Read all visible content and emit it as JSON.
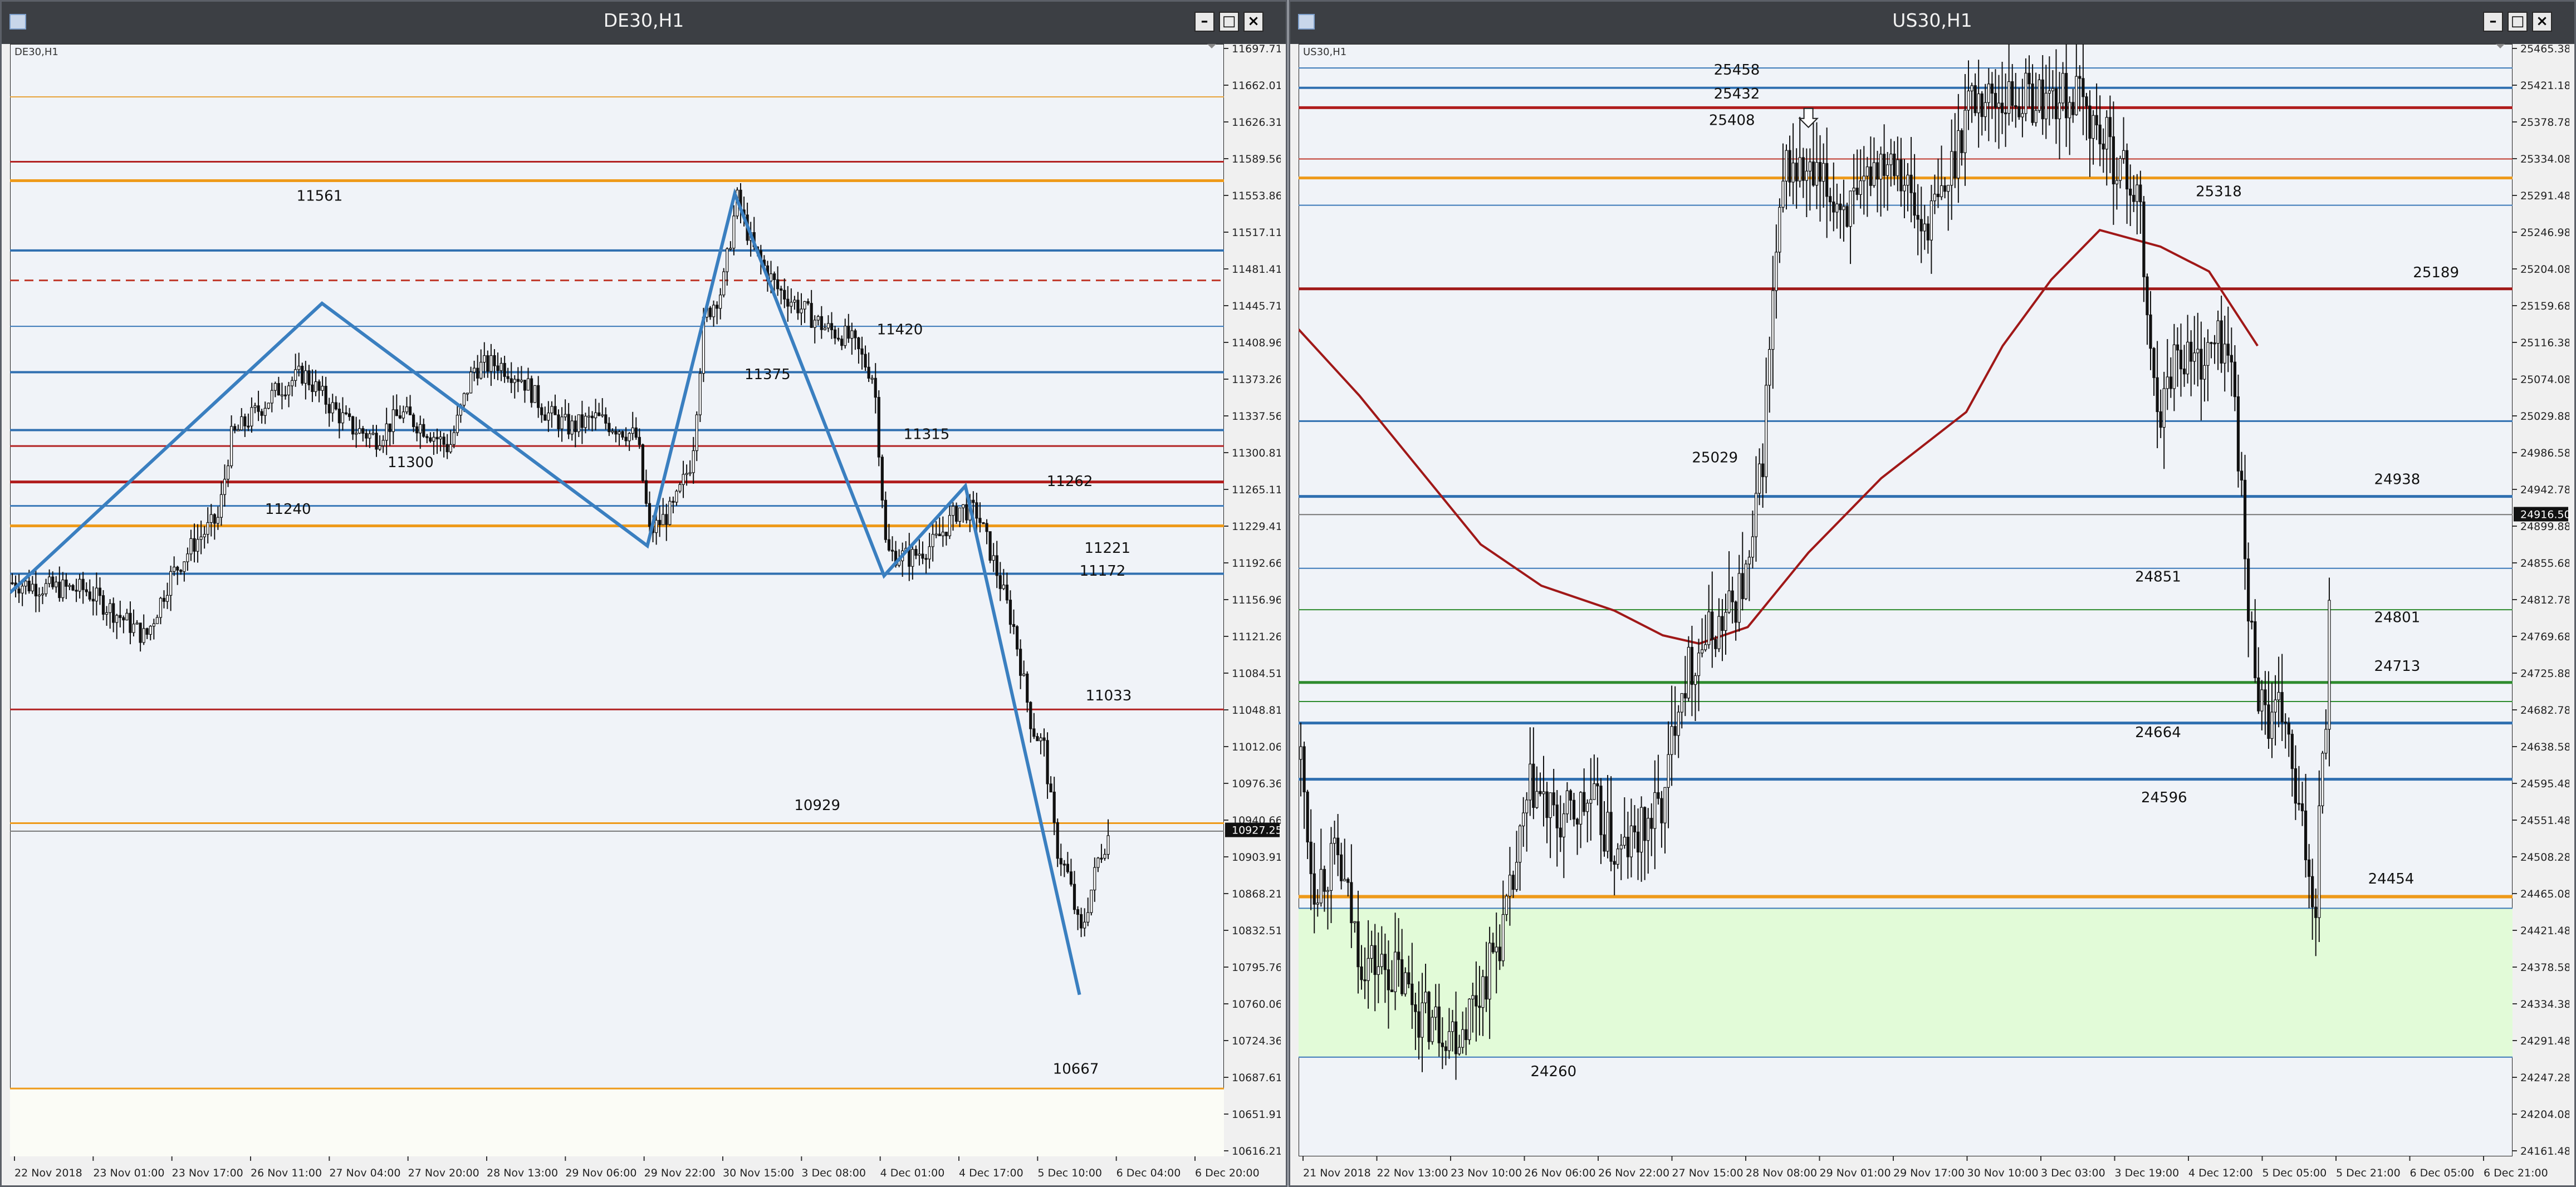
{
  "windows": [
    {
      "id": "de30",
      "title": "DE30,H1",
      "symbol_label": "DE30,H1",
      "min": 10600,
      "max": 11715,
      "y_ticks": [
        "11697.71",
        "11662.01",
        "11626.31",
        "11589.56",
        "11553.86",
        "11517.11",
        "11481.41",
        "11445.71",
        "11408.96",
        "11373.26",
        "11337.56",
        "11300.81",
        "11265.11",
        "11229.41",
        "11192.66",
        "11156.96",
        "11121.26",
        "11084.51",
        "11048.81",
        "11012.06",
        "10976.36",
        "10940.66",
        "10903.91",
        "10868.21",
        "10832.51",
        "10795.76",
        "10760.06",
        "10724.36",
        "10687.61",
        "10651.91",
        "10616.21"
      ],
      "price_tag": "10927.25",
      "price_tag_value": 10927.25,
      "x_labels": [
        "22 Nov 2018",
        "23 Nov 01:00",
        "23 Nov 17:00",
        "26 Nov 11:00",
        "27 Nov 04:00",
        "27 Nov 20:00",
        "28 Nov 13:00",
        "29 Nov 06:00",
        "29 Nov 22:00",
        "30 Nov 15:00",
        "3 Dec 08:00",
        "4 Dec 01:00",
        "4 Dec 17:00",
        "5 Dec 10:00",
        "6 Dec 04:00",
        "6 Dec 20:00"
      ],
      "levels": [
        {
          "v": 11662,
          "color": "#e8a33a",
          "w": 2,
          "dash": false
        },
        {
          "v": 11597,
          "color": "#b22222",
          "w": 3,
          "dash": false
        },
        {
          "v": 11578,
          "color": "#ee9a1a",
          "w": 5,
          "dash": false
        },
        {
          "v": 11508,
          "color": "#2f6fb0",
          "w": 4,
          "dash": false
        },
        {
          "v": 11478,
          "color": "#c0392b",
          "w": 3,
          "dash": true
        },
        {
          "v": 11432,
          "color": "#3a78b8",
          "w": 2,
          "dash": false
        },
        {
          "v": 11386,
          "color": "#2f6fb0",
          "w": 4,
          "dash": false
        },
        {
          "v": 11328,
          "color": "#2f6fb0",
          "w": 4,
          "dash": false
        },
        {
          "v": 11312,
          "color": "#b22222",
          "w": 3,
          "dash": false
        },
        {
          "v": 11276,
          "color": "#b01c1c",
          "w": 5,
          "dash": false
        },
        {
          "v": 11252,
          "color": "#3a78b8",
          "w": 3,
          "dash": false
        },
        {
          "v": 11232,
          "color": "#ee9a1a",
          "w": 5,
          "dash": false
        },
        {
          "v": 11184,
          "color": "#2f6fb0",
          "w": 4,
          "dash": false
        },
        {
          "v": 11048,
          "color": "#b22222",
          "w": 3,
          "dash": false
        },
        {
          "v": 10934,
          "color": "#ee9a1a",
          "w": 3,
          "dash": false
        },
        {
          "v": 10926,
          "color": "#777777",
          "w": 2,
          "dash": false
        },
        {
          "v": 10668,
          "color": "#ee9a1a",
          "w": 3,
          "dash": false
        }
      ],
      "labels": [
        {
          "text": "11561",
          "xf": 0.255,
          "v": 11558
        },
        {
          "text": "11420",
          "xf": 0.733,
          "v": 11424
        },
        {
          "text": "11375",
          "xf": 0.624,
          "v": 11379
        },
        {
          "text": "11315",
          "xf": 0.755,
          "v": 11319
        },
        {
          "text": "11300",
          "xf": 0.33,
          "v": 11291
        },
        {
          "text": "11262",
          "xf": 0.873,
          "v": 11272
        },
        {
          "text": "11240",
          "xf": 0.229,
          "v": 11244
        },
        {
          "text": "11221",
          "xf": 0.904,
          "v": 11205
        },
        {
          "text": "11172",
          "xf": 0.9,
          "v": 11182
        },
        {
          "text": "11033",
          "xf": 0.905,
          "v": 11057
        },
        {
          "text": "10929",
          "xf": 0.665,
          "v": 10947
        },
        {
          "text": "10667",
          "xf": 0.878,
          "v": 10683
        }
      ],
      "pattern": [
        [
          0.0,
          11165
        ],
        [
          0.257,
          11455
        ],
        [
          0.525,
          11212
        ],
        [
          0.597,
          11565
        ],
        [
          0.72,
          11182
        ],
        [
          0.787,
          11272
        ],
        [
          0.881,
          10762
        ]
      ],
      "path": [
        [
          0,
          11175
        ],
        [
          0.03,
          11170
        ],
        [
          0.06,
          11168
        ],
        [
          0.09,
          11140
        ],
        [
          0.11,
          11120
        ],
        [
          0.13,
          11180
        ],
        [
          0.15,
          11215
        ],
        [
          0.17,
          11240
        ],
        [
          0.18,
          11320
        ],
        [
          0.2,
          11345
        ],
        [
          0.22,
          11370
        ],
        [
          0.24,
          11385
        ],
        [
          0.26,
          11355
        ],
        [
          0.28,
          11330
        ],
        [
          0.3,
          11320
        ],
        [
          0.32,
          11345
        ],
        [
          0.34,
          11330
        ],
        [
          0.36,
          11310
        ],
        [
          0.38,
          11390
        ],
        [
          0.4,
          11395
        ],
        [
          0.42,
          11380
        ],
        [
          0.44,
          11345
        ],
        [
          0.46,
          11330
        ],
        [
          0.48,
          11340
        ],
        [
          0.5,
          11330
        ],
        [
          0.515,
          11320
        ],
        [
          0.525,
          11225
        ],
        [
          0.545,
          11250
        ],
        [
          0.56,
          11300
        ],
        [
          0.57,
          11440
        ],
        [
          0.585,
          11470
        ],
        [
          0.597,
          11560
        ],
        [
          0.61,
          11510
        ],
        [
          0.63,
          11470
        ],
        [
          0.65,
          11450
        ],
        [
          0.67,
          11430
        ],
        [
          0.69,
          11420
        ],
        [
          0.71,
          11380
        ],
        [
          0.72,
          11205
        ],
        [
          0.74,
          11200
        ],
        [
          0.76,
          11215
        ],
        [
          0.78,
          11250
        ],
        [
          0.795,
          11245
        ],
        [
          0.81,
          11190
        ],
        [
          0.825,
          11130
        ],
        [
          0.84,
          11030
        ],
        [
          0.85,
          11010
        ],
        [
          0.86,
          10910
        ],
        [
          0.87,
          10880
        ],
        [
          0.88,
          10820
        ],
        [
          0.895,
          10900
        ],
        [
          0.905,
          10927
        ]
      ],
      "vol": 14,
      "seed": 7
    },
    {
      "id": "us30",
      "title": "US30,H1",
      "symbol_label": "US30,H1",
      "min": 24140,
      "max": 25485,
      "y_ticks": [
        "25465.38",
        "25421.18",
        "25378.78",
        "25334.08",
        "25291.48",
        "25246.98",
        "25204.08",
        "25159.68",
        "25116.38",
        "25074.08",
        "25029.88",
        "24986.58",
        "24942.78",
        "24899.88",
        "24855.68",
        "24812.78",
        "24769.68",
        "24725.88",
        "24682.78",
        "24638.58",
        "24595.48",
        "24551.48",
        "24508.28",
        "24465.08",
        "24421.48",
        "24378.58",
        "24334.38",
        "24291.48",
        "24247.28",
        "24204.08",
        "24161.48"
      ],
      "price_tag": "24916.50",
      "price_tag_value": 24916.5,
      "x_labels": [
        "21 Nov 2018",
        "22 Nov 13:00",
        "23 Nov 10:00",
        "26 Nov 06:00",
        "26 Nov 22:00",
        "27 Nov 15:00",
        "28 Nov 08:00",
        "29 Nov 01:00",
        "29 Nov 17:00",
        "30 Nov 10:00",
        "3 Dec 03:00",
        "3 Dec 19:00",
        "4 Dec 12:00",
        "5 Dec 05:00",
        "5 Dec 21:00",
        "6 Dec 05:00",
        "6 Dec 21:00"
      ],
      "levels": [
        {
          "v": 25456,
          "color": "#3a78b8",
          "w": 2,
          "dash": false
        },
        {
          "v": 25432,
          "color": "#2f6fb0",
          "w": 4,
          "dash": false
        },
        {
          "v": 25408,
          "color": "#b01c1c",
          "w": 5,
          "dash": false
        },
        {
          "v": 25346,
          "color": "#c0392b",
          "w": 2,
          "dash": false
        },
        {
          "v": 25323,
          "color": "#ee9a1a",
          "w": 5,
          "dash": false
        },
        {
          "v": 25290,
          "color": "#3a78b8",
          "w": 2,
          "dash": false
        },
        {
          "v": 25189,
          "color": "#a01818",
          "w": 5,
          "dash": false
        },
        {
          "v": 25029,
          "color": "#2f6fb0",
          "w": 3,
          "dash": false
        },
        {
          "v": 24938,
          "color": "#2f6fb0",
          "w": 5,
          "dash": false
        },
        {
          "v": 24916,
          "color": "#777777",
          "w": 2,
          "dash": false
        },
        {
          "v": 24851,
          "color": "#3a78b8",
          "w": 2,
          "dash": false
        },
        {
          "v": 24801,
          "color": "#2e8b2e",
          "w": 2,
          "dash": false
        },
        {
          "v": 24713,
          "color": "#2e8b2e",
          "w": 5,
          "dash": false
        },
        {
          "v": 24690,
          "color": "#2e8b2e",
          "w": 2,
          "dash": false
        },
        {
          "v": 24664,
          "color": "#2f6fb0",
          "w": 5,
          "dash": false
        },
        {
          "v": 24596,
          "color": "#2f6fb0",
          "w": 5,
          "dash": false
        },
        {
          "v": 24454,
          "color": "#ee9a1a",
          "w": 6,
          "dash": false
        },
        {
          "v": 24440,
          "color": "#3a78b8",
          "w": 2,
          "dash": false
        },
        {
          "v": 24260,
          "color": "#3a78b8",
          "w": 2,
          "dash": false
        }
      ],
      "zone": {
        "top": 24440,
        "bottom": 24260,
        "color": "#e2fbd8"
      },
      "labels": [
        {
          "text": "25458",
          "xf": 0.361,
          "v": 25448
        },
        {
          "text": "25432",
          "xf": 0.361,
          "v": 25419
        },
        {
          "text": "25408",
          "xf": 0.357,
          "v": 25387
        },
        {
          "text": "25318",
          "xf": 0.758,
          "v": 25301
        },
        {
          "text": "25189",
          "xf": 0.937,
          "v": 25203
        },
        {
          "text": "25029",
          "xf": 0.343,
          "v": 24979
        },
        {
          "text": "24938",
          "xf": 0.905,
          "v": 24953
        },
        {
          "text": "24851",
          "xf": 0.708,
          "v": 24835
        },
        {
          "text": "24801",
          "xf": 0.905,
          "v": 24786
        },
        {
          "text": "24713",
          "xf": 0.905,
          "v": 24727
        },
        {
          "text": "24664",
          "xf": 0.708,
          "v": 24647
        },
        {
          "text": "24596",
          "xf": 0.713,
          "v": 24568
        },
        {
          "text": "24454",
          "xf": 0.9,
          "v": 24470
        },
        {
          "text": "24260",
          "xf": 0.21,
          "v": 24237
        }
      ],
      "ma": [
        [
          0.0,
          25140
        ],
        [
          0.05,
          25060
        ],
        [
          0.1,
          24970
        ],
        [
          0.15,
          24880
        ],
        [
          0.2,
          24830
        ],
        [
          0.26,
          24800
        ],
        [
          0.3,
          24770
        ],
        [
          0.33,
          24760
        ],
        [
          0.37,
          24780
        ],
        [
          0.42,
          24870
        ],
        [
          0.48,
          24960
        ],
        [
          0.55,
          25040
        ],
        [
          0.58,
          25120
        ],
        [
          0.62,
          25200
        ],
        [
          0.66,
          25260
        ],
        [
          0.71,
          25240
        ],
        [
          0.75,
          25210
        ],
        [
          0.79,
          25120
        ]
      ],
      "path": [
        [
          0,
          24620
        ],
        [
          0.01,
          24470
        ],
        [
          0.03,
          24500
        ],
        [
          0.05,
          24380
        ],
        [
          0.08,
          24360
        ],
        [
          0.1,
          24310
        ],
        [
          0.13,
          24290
        ],
        [
          0.15,
          24350
        ],
        [
          0.17,
          24430
        ],
        [
          0.19,
          24590
        ],
        [
          0.21,
          24540
        ],
        [
          0.24,
          24570
        ],
        [
          0.26,
          24500
        ],
        [
          0.28,
          24530
        ],
        [
          0.3,
          24570
        ],
        [
          0.31,
          24700
        ],
        [
          0.33,
          24760
        ],
        [
          0.35,
          24790
        ],
        [
          0.37,
          24850
        ],
        [
          0.38,
          24980
        ],
        [
          0.39,
          25200
        ],
        [
          0.4,
          25340
        ],
        [
          0.42,
          25320
        ],
        [
          0.44,
          25300
        ],
        [
          0.46,
          25280
        ],
        [
          0.47,
          25340
        ],
        [
          0.49,
          25360
        ],
        [
          0.51,
          25260
        ],
        [
          0.53,
          25300
        ],
        [
          0.55,
          25420
        ],
        [
          0.6,
          25420
        ],
        [
          0.64,
          25420
        ],
        [
          0.69,
          25300
        ],
        [
          0.7,
          25100
        ],
        [
          0.71,
          25040
        ],
        [
          0.72,
          25120
        ],
        [
          0.74,
          25100
        ],
        [
          0.76,
          25130
        ],
        [
          0.77,
          25060
        ],
        [
          0.78,
          24800
        ],
        [
          0.79,
          24700
        ],
        [
          0.8,
          24660
        ],
        [
          0.81,
          24680
        ],
        [
          0.82,
          24560
        ],
        [
          0.83,
          24500
        ],
        [
          0.835,
          24420
        ],
        [
          0.84,
          24600
        ],
        [
          0.845,
          24700
        ],
        [
          0.85,
          24910
        ]
      ],
      "vol": 42,
      "seed": 13
    }
  ]
}
